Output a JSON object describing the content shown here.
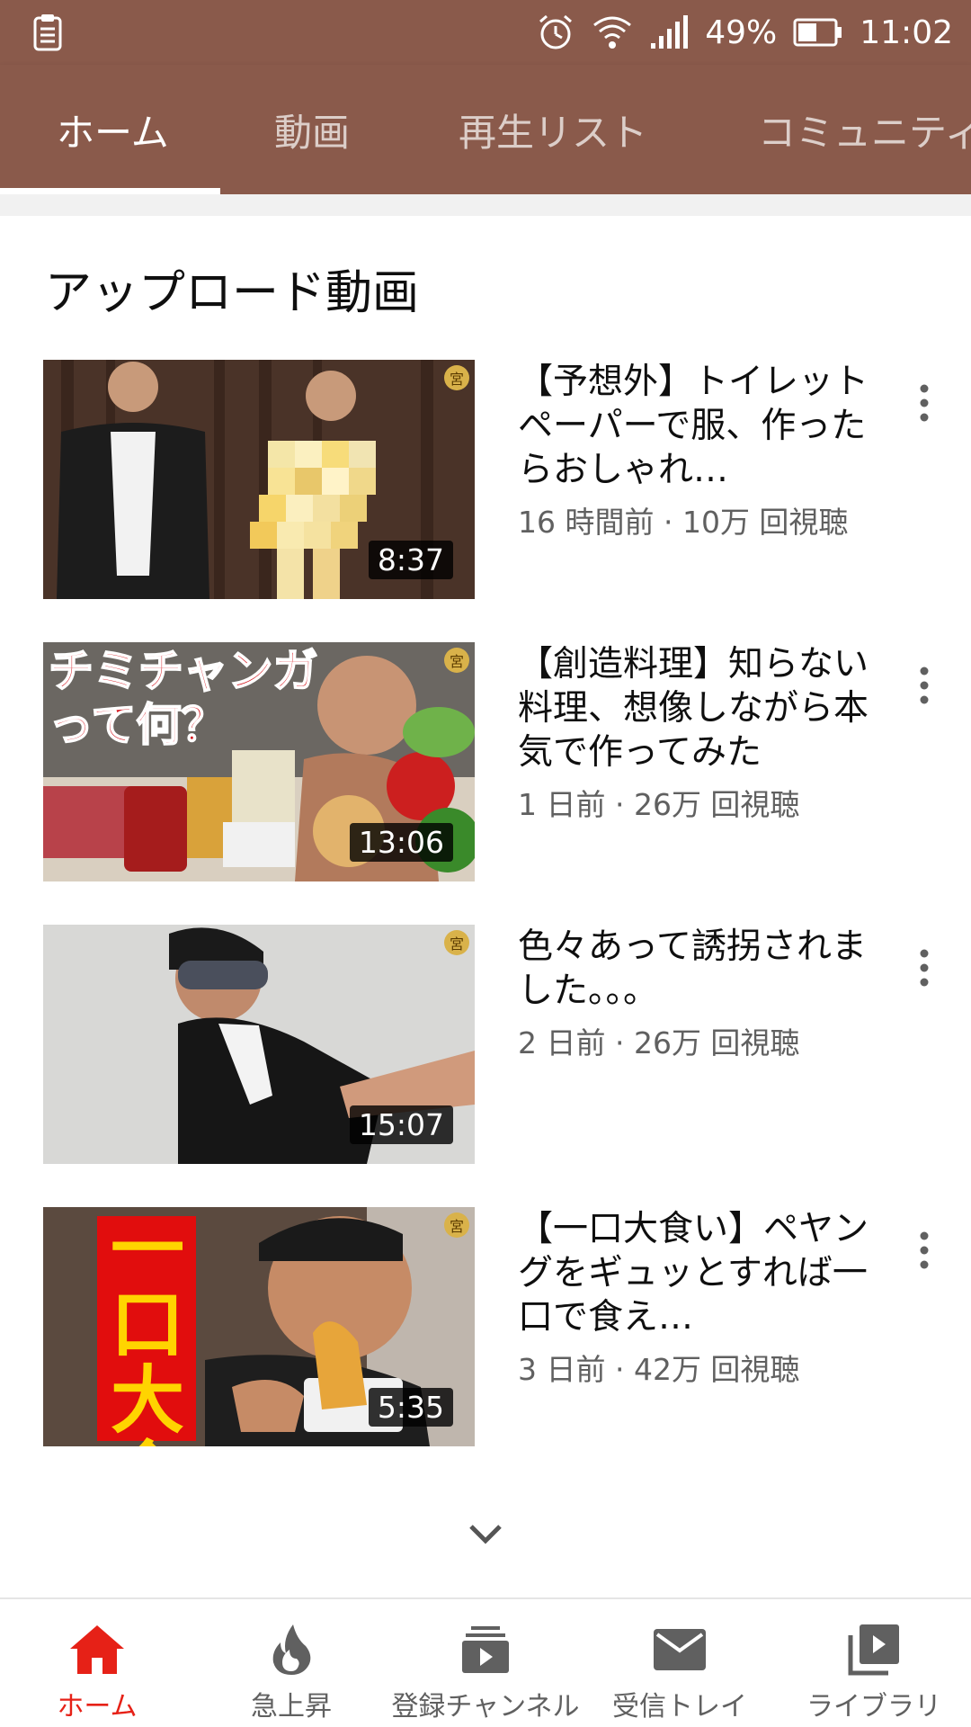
{
  "status_bar": {
    "battery": "49%",
    "time": "11:02"
  },
  "tabs": [
    {
      "label": "ホーム",
      "active": true
    },
    {
      "label": "動画",
      "active": false
    },
    {
      "label": "再生リスト",
      "active": false
    },
    {
      "label": "コミュニティ",
      "active": false
    }
  ],
  "section": {
    "title": "アップロード動画"
  },
  "videos": [
    {
      "title": "【予想外】トイレットペーパーで服、作ったらおしゃれ…",
      "meta": "16 時間前 · 10万 回視聴",
      "duration": "8:37"
    },
    {
      "title": "【創造料理】知らない料理、想像しながら本気で作ってみた",
      "meta": "1 日前 · 26万 回視聴",
      "duration": "13:06",
      "thumb_text": "チミチャンガって何？"
    },
    {
      "title": "色々あって誘拐されました。。。",
      "meta": "2 日前 · 26万 回視聴",
      "duration": "15:07"
    },
    {
      "title": "【一口大食い】ペヤングをギュッとすれば一口で食え…",
      "meta": "3 日前 · 42万 回視聴",
      "duration": "5:35",
      "thumb_text": "一口大食"
    }
  ],
  "badge_glyph": "宮",
  "bottom_nav": [
    {
      "label": "ホーム",
      "icon": "home-icon",
      "active": true
    },
    {
      "label": "急上昇",
      "icon": "trending-flame-icon",
      "active": false
    },
    {
      "label": "登録チャンネル",
      "icon": "subscriptions-icon",
      "active": false
    },
    {
      "label": "受信トレイ",
      "icon": "inbox-mail-icon",
      "active": false
    },
    {
      "label": "ライブラリ",
      "icon": "library-icon",
      "active": false
    }
  ],
  "colors": {
    "header_brown": "#8a5a4b",
    "active_red": "#e62117",
    "meta_gray": "#606060"
  }
}
